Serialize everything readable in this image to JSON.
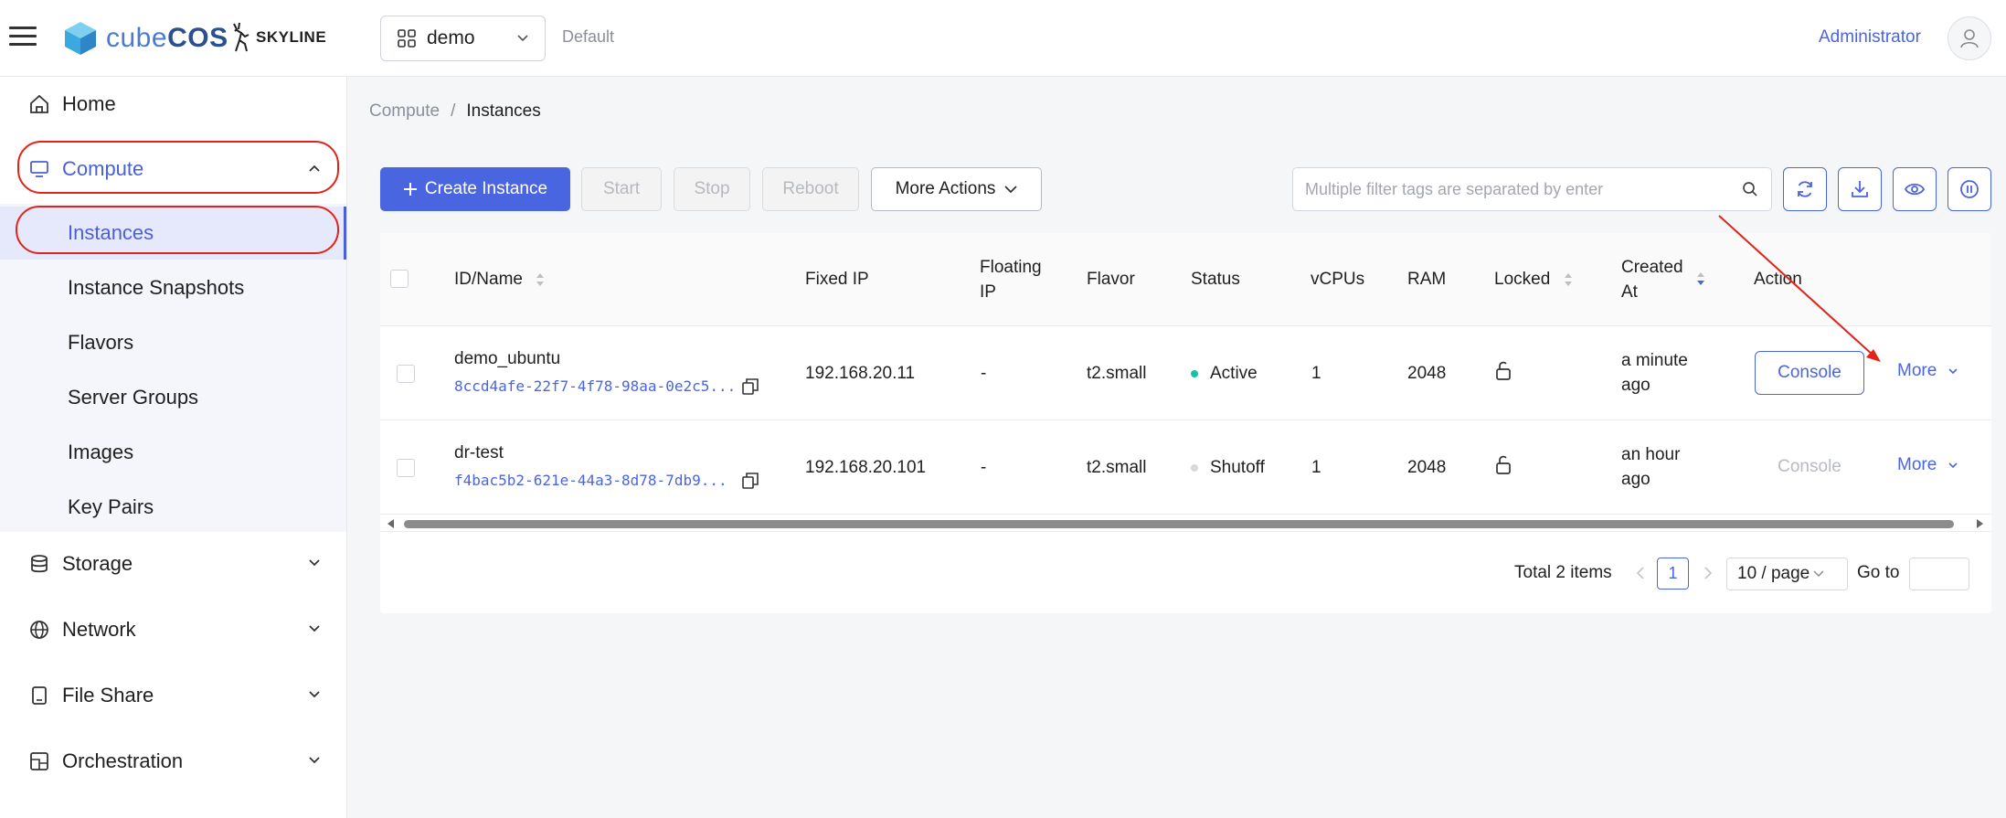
{
  "header": {
    "logo_cube": "cube",
    "logo_cos": "COS",
    "skyline": "SKYLINE",
    "project": "demo",
    "domain": "Default",
    "user": "Administrator"
  },
  "sidebar": {
    "home": "Home",
    "compute": "Compute",
    "compute_items": [
      "Instances",
      "Instance Snapshots",
      "Flavors",
      "Server Groups",
      "Images",
      "Key Pairs"
    ],
    "storage": "Storage",
    "network": "Network",
    "file_share": "File Share",
    "orchestration": "Orchestration"
  },
  "breadcrumb": {
    "parent": "Compute",
    "separator": "/",
    "current": "Instances"
  },
  "toolbar": {
    "create": "Create Instance",
    "start": "Start",
    "stop": "Stop",
    "reboot": "Reboot",
    "more_actions": "More Actions",
    "search_placeholder": "Multiple filter tags are separated by enter"
  },
  "table": {
    "columns": {
      "id_name": "ID/Name",
      "fixed_ip": "Fixed IP",
      "floating_ip_1": "Floating",
      "floating_ip_2": "IP",
      "flavor": "Flavor",
      "status": "Status",
      "vcpus": "vCPUs",
      "ram": "RAM",
      "locked": "Locked",
      "created_1": "Created",
      "created_2": "At",
      "action": "Action"
    },
    "rows": [
      {
        "name": "demo_ubuntu",
        "id": "8ccd4afe-22f7-4f78-98aa-0e2c5...",
        "fixed_ip": "192.168.20.11",
        "floating_ip": "-",
        "flavor": "t2.small",
        "status": "Active",
        "status_color": "#17c3a2",
        "vcpus": "1",
        "ram": "2048",
        "created_1": "a minute",
        "created_2": "ago",
        "console": "Console",
        "more": "More"
      },
      {
        "name": "dr-test",
        "id": "f4bac5b2-621e-44a3-8d78-7db9...",
        "fixed_ip": "192.168.20.101",
        "floating_ip": "-",
        "flavor": "t2.small",
        "status": "Shutoff",
        "status_color": "#d9d9d9",
        "vcpus": "1",
        "ram": "2048",
        "created_1": "an hour",
        "created_2": "ago",
        "console": "Console",
        "more": "More"
      }
    ]
  },
  "pagination": {
    "total": "Total 2 items",
    "page": "1",
    "page_size": "10 / page",
    "goto": "Go to"
  },
  "colors": {
    "accent": "#4a65e0",
    "annotation": "#e2231a"
  }
}
